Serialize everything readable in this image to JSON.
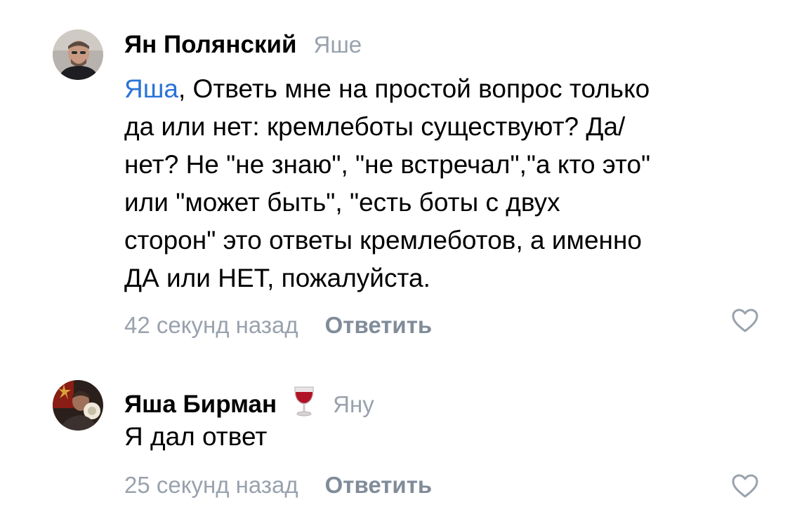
{
  "comments": [
    {
      "author": "Ян Полянский",
      "reply_to": "Яше",
      "mention": "Яша",
      "text_lines": [
        ", Ответь мне на простой вопрос только",
        "да или нет: кремлеботы существуют? Да/",
        "нет?  Не \"не знаю\", \"не встречал\",\"а кто это\"",
        "или \"может быть\", \"есть боты с двух",
        "сторон\" это ответы кремлеботов, а именно",
        "ДА или НЕТ, пожалуйста."
      ],
      "time": "42 секунд назад",
      "reply_label": "Ответить",
      "like_icon": "heart-outline-icon"
    },
    {
      "author": "Яша Бирман",
      "author_badge_icon": "wine-glass-icon",
      "reply_to": "Яну",
      "text_lines": [
        "Я дал ответ"
      ],
      "time": "25 секунд назад",
      "reply_label": "Ответить",
      "like_icon": "heart-outline-icon"
    }
  ],
  "colors": {
    "mention": "#2a73d6",
    "secondary_text": "#99a2ad",
    "action_text": "#818c99",
    "like_icon": "#99a2ad"
  }
}
